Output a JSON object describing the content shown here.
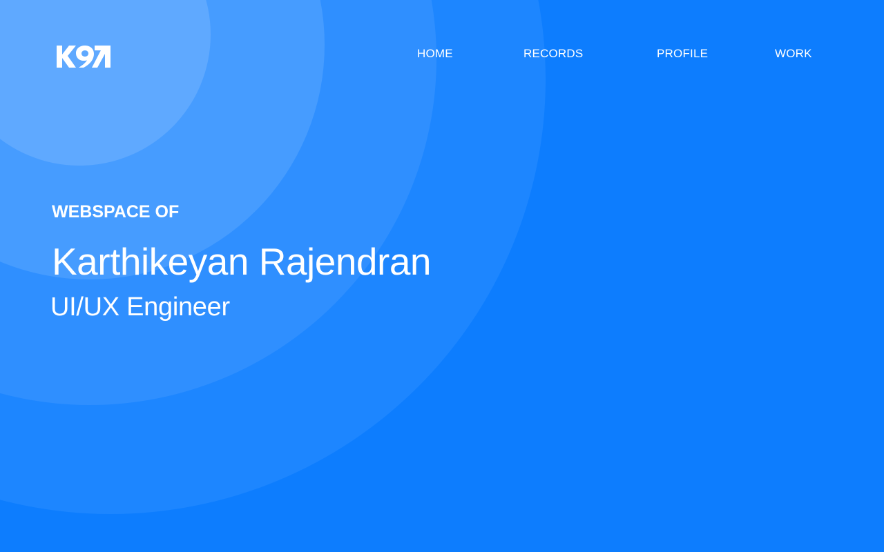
{
  "site": {
    "logo_text": "K97",
    "brand_color": "#0d7dfe"
  },
  "nav": {
    "items": [
      {
        "label": "HOME"
      },
      {
        "label": "RECORDS"
      },
      {
        "label": "PROFILE"
      },
      {
        "label": "WORK"
      }
    ]
  },
  "hero": {
    "eyebrow": "WEBSPACE OF",
    "name": "Karthikeyan Rajendran",
    "role": "UI/UX Engineer"
  },
  "colors": {
    "background": "#0d7dfe",
    "ring_outer": "#1d86ff",
    "ring_2": "#2f8fff",
    "ring_3": "#469cff",
    "ring_4": "#58a6ff",
    "ring_inner": "#66adff",
    "text": "#ffffff"
  }
}
